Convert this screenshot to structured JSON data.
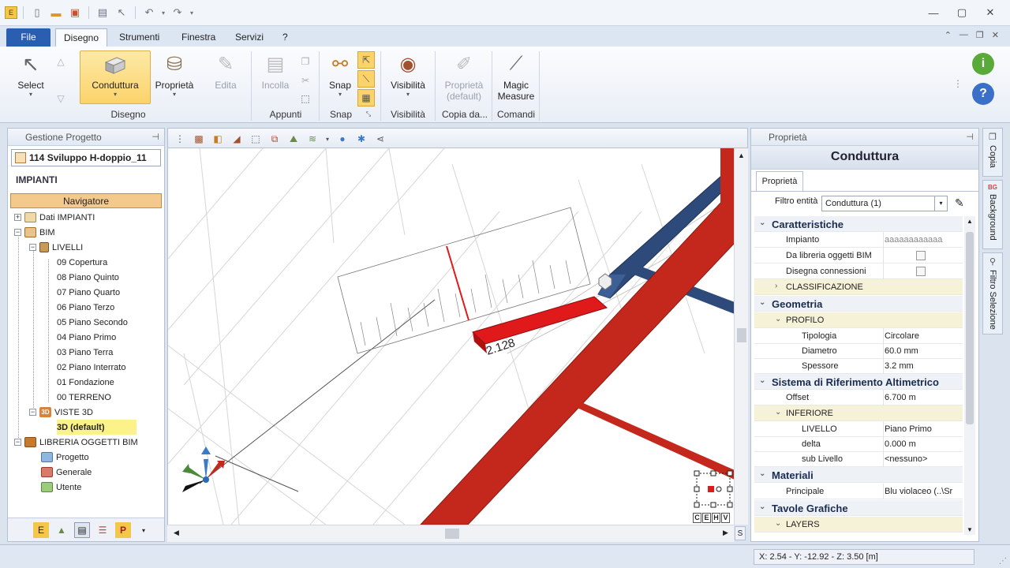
{
  "window": {
    "qat_icons": [
      "app-icon",
      "new-icon",
      "open-icon",
      "save-icon",
      "print-icon",
      "pointer-icon",
      "undo-icon",
      "redo-icon"
    ],
    "controls": [
      "minimize",
      "maximize",
      "close"
    ]
  },
  "tabs": {
    "file": "File",
    "items": [
      "Disegno",
      "Strumenti",
      "Finestra",
      "Servizi",
      "?"
    ]
  },
  "ribbon": {
    "select": "Select",
    "conduttura": "Conduttura",
    "proprieta": "Proprietà",
    "edita": "Edita",
    "incolla": "Incolla",
    "snap": "Snap",
    "visibilita": "Visibilità",
    "proprieta_default_1": "Proprietà",
    "proprieta_default_2": "(default)",
    "magic_1": "Magic",
    "magic_2": "Measure",
    "groups": {
      "disegno": "Disegno",
      "appunti": "Appunti",
      "snap": "Snap",
      "visibilita": "Visibilità",
      "copia": "Copia da...",
      "comandi": "Comandi"
    }
  },
  "left_panel": {
    "title": "Gestione Progetto",
    "project": "114 Sviluppo H-doppio_11",
    "section": "IMPIANTI",
    "navigator": "Navigatore",
    "tree": {
      "dati": "Dati IMPIANTI",
      "bim": "BIM",
      "livelli": "LIVELLI",
      "l09": "09 Copertura",
      "l08": "08 Piano Quinto",
      "l07": "07 Piano Quarto",
      "l06": "06 Piano Terzo",
      "l05": "05 Piano Secondo",
      "l04": "04 Piano Primo",
      "l03": "03 Piano Terra",
      "l02": "02 Piano Interrato",
      "l01": "01 Fondazione",
      "l00": "00 TERRENO",
      "viste": "VISTE 3D",
      "v3d": "3D (default)",
      "libreria": "LIBRERIA OGGETTI BIM",
      "progetto": "Progetto",
      "generale": "Generale",
      "utente": "Utente"
    }
  },
  "viewport": {
    "dimension_label": "2.128",
    "view_buttons": [
      "C",
      "E",
      "H",
      "V"
    ],
    "scroll_corner": "S",
    "colors": {
      "blue_duct": "#2d4a7a",
      "red_duct": "#c4281c",
      "selected": "#e0191b"
    }
  },
  "right_panel": {
    "header": "Proprietà",
    "title": "Conduttura",
    "tab": "Proprietà",
    "filter_label": "Filtro entità",
    "filter_value": "Conduttura (1)",
    "rows": {
      "caratteristiche": "Caratteristiche",
      "impianto_k": "Impianto",
      "impianto_v": "aaaaaaaaaaaa",
      "libreria_k": "Da libreria oggetti BIM",
      "connessioni_k": "Disegna connessioni",
      "classificazione": "CLASSIFICAZIONE",
      "geometria": "Geometria",
      "profilo": "PROFILO",
      "tipologia_k": "Tipologia",
      "tipologia_v": "Circolare",
      "diametro_k": "Diametro",
      "diametro_v": "60.0 mm",
      "spessore_k": "Spessore",
      "spessore_v": "3.2 mm",
      "sistema": "Sistema di Riferimento Altimetrico",
      "offset_k": "Offset",
      "offset_v": "6.700 m",
      "inferiore": "INFERIORE",
      "livello_k": "LIVELLO",
      "livello_v": "Piano Primo",
      "delta_k": "delta",
      "delta_v": "0.000 m",
      "sublivello_k": "sub Livello",
      "sublivello_v": "<nessuno>",
      "materiali": "Materiali",
      "principale_k": "Principale",
      "principale_v": "Blu violaceo    (..\\Sr",
      "tavole": "Tavole Grafiche",
      "layers": "LAYERS"
    }
  },
  "side_tabs": [
    "Copia",
    "Background",
    "Filtro Selezione"
  ],
  "status": {
    "coords": "X: 2.54 - Y: -12.92 - Z: 3.50 [m]"
  }
}
